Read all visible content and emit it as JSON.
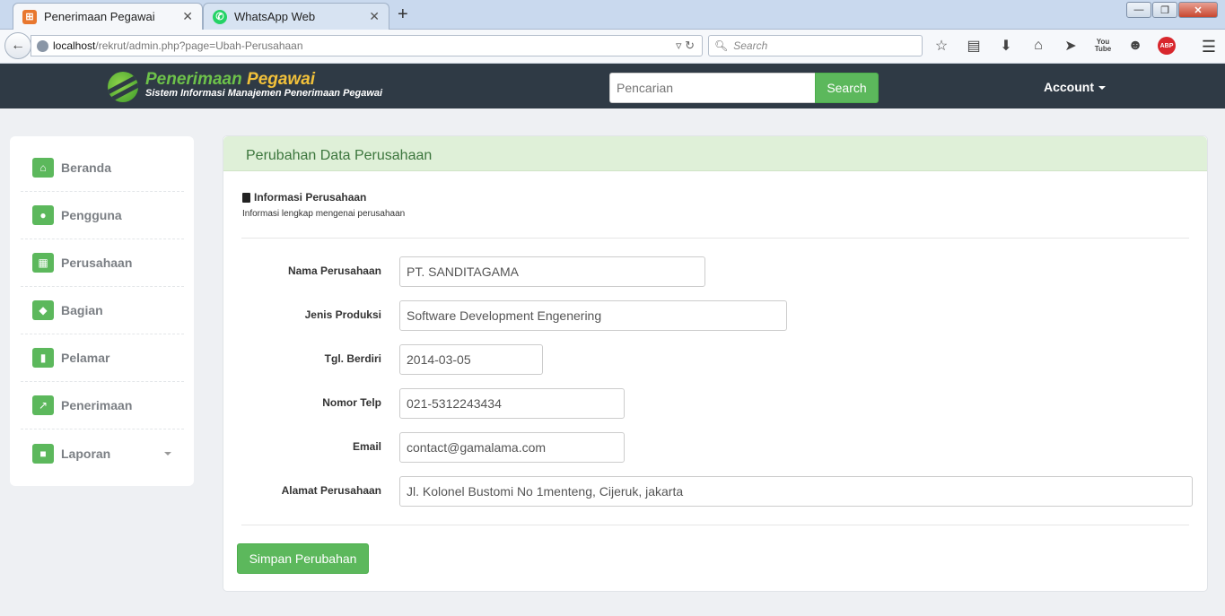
{
  "browser": {
    "tabs": [
      {
        "title": "Penerimaan Pegawai",
        "active": true,
        "icon": "xampp-icon"
      },
      {
        "title": "WhatsApp Web",
        "active": false,
        "icon": "whatsapp-icon"
      }
    ],
    "url_host": "localhost",
    "url_path": "/rekrut/admin.php?page=Ubah-Perusahaan",
    "search_placeholder": "Search",
    "abp_label": "ABP",
    "youtube_label": "You Tube"
  },
  "header": {
    "brand_title_part1": "Penerimaan",
    "brand_title_part2": "Pegawai",
    "brand_subtitle": "Sistem Informasi Manajemen Penerimaan Pegawai",
    "search_placeholder": "Pencarian",
    "search_button": "Search",
    "account_label": "Account"
  },
  "sidebar": {
    "items": [
      {
        "label": "Beranda",
        "icon": "home-icon"
      },
      {
        "label": "Pengguna",
        "icon": "user-icon"
      },
      {
        "label": "Perusahaan",
        "icon": "picture-icon"
      },
      {
        "label": "Bagian",
        "icon": "tags-icon"
      },
      {
        "label": "Pelamar",
        "icon": "stats-icon"
      },
      {
        "label": "Penerimaan",
        "icon": "share-icon"
      },
      {
        "label": "Laporan",
        "icon": "book-icon",
        "has_dropdown": true
      }
    ]
  },
  "main": {
    "panel_title": "Perubahan Data Perusahaan",
    "section_title": "Informasi Perusahaan",
    "section_subtitle": "Informasi lengkap mengenai perusahaan",
    "fields": [
      {
        "label": "Nama Perusahaan",
        "value": "PT. SANDITAGAMA"
      },
      {
        "label": "Jenis Produksi",
        "value": "Software Development Engenering"
      },
      {
        "label": "Tgl. Berdiri",
        "value": "2014-03-05"
      },
      {
        "label": "Nomor Telp",
        "value": "021-5312243434"
      },
      {
        "label": "Email",
        "value": "contact@gamalama.com"
      },
      {
        "label": "Alamat Perusahaan",
        "value": "Jl. Kolonel Bustomi No 1menteng, Cijeruk, jakarta"
      }
    ],
    "save_button": "Simpan Perubahan"
  },
  "colors": {
    "accent_green": "#5cb85c",
    "header_dark": "#2f3a45",
    "panel_head_bg": "#dff0d8",
    "panel_title": "#3c763d"
  }
}
